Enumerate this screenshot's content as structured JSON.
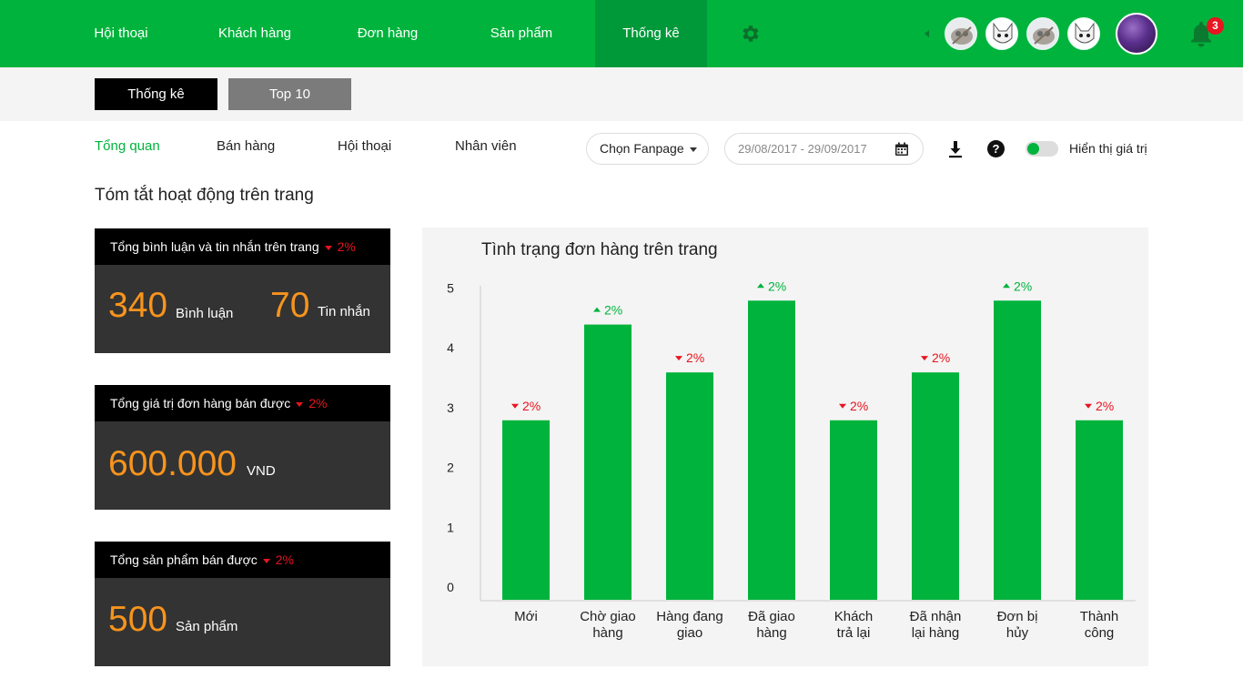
{
  "nav": {
    "items": [
      "Hội thoại",
      "Khách hàng",
      "Đơn hàng",
      "Sản phẩm",
      "Thống kê"
    ],
    "active": "Thống kê",
    "notification_count": "3"
  },
  "subtabs": [
    "Thống kê",
    "Top 10"
  ],
  "sec_tabs": [
    "Tổng quan",
    "Bán hàng",
    "Hội thoại",
    "Nhân viên"
  ],
  "filters": {
    "fanpage_label": "Chọn Fanpage",
    "date_range": "29/08/2017 - 29/09/2017",
    "toggle_label": "Hiển thị giá trị",
    "help_label": "?"
  },
  "section_title": "Tóm tắt hoạt động trên trang",
  "cards": {
    "comments": {
      "title": "Tổng bình luận và tin nhắn trên trang",
      "change": "2%",
      "value1": "340",
      "unit1": "Bình luận",
      "value2": "70",
      "unit2": "Tin nhắn"
    },
    "revenue": {
      "title": "Tổng giá trị đơn hàng bán được",
      "change": "2%",
      "value": "600.000",
      "unit": "VND"
    },
    "products": {
      "title": "Tổng sản phẩm bán được",
      "change": "2%",
      "value": "500",
      "unit": "Sản phẩm"
    }
  },
  "colors": {
    "brand": "#00b33c",
    "accent": "#f7941d",
    "down": "#e8141f",
    "up": "#00b33c"
  },
  "chart_data": {
    "type": "bar",
    "title": "Tình trạng đơn hàng trên trang",
    "categories": [
      [
        "Mới"
      ],
      [
        "Chờ giao",
        "hàng"
      ],
      [
        "Hàng đang",
        "giao"
      ],
      [
        "Đã giao",
        "hàng"
      ],
      [
        "Khách",
        "trả lại"
      ],
      [
        "Đã nhận",
        "lại hàng"
      ],
      [
        "Đơn bị",
        "hủy"
      ],
      [
        "Thành",
        "công"
      ]
    ],
    "values": [
      3.0,
      4.6,
      3.8,
      5.0,
      3.0,
      3.8,
      5.0,
      3.0
    ],
    "changes": [
      {
        "dir": "down",
        "label": "2%"
      },
      {
        "dir": "up",
        "label": "2%"
      },
      {
        "dir": "down",
        "label": "2%"
      },
      {
        "dir": "up",
        "label": "2%"
      },
      {
        "dir": "down",
        "label": "2%"
      },
      {
        "dir": "down",
        "label": "2%"
      },
      {
        "dir": "up",
        "label": "2%"
      },
      {
        "dir": "down",
        "label": "2%"
      }
    ],
    "yticks": [
      0,
      1,
      2,
      3,
      4,
      5
    ],
    "ylim": [
      0,
      5.4
    ],
    "grid": false,
    "legend": "none"
  }
}
